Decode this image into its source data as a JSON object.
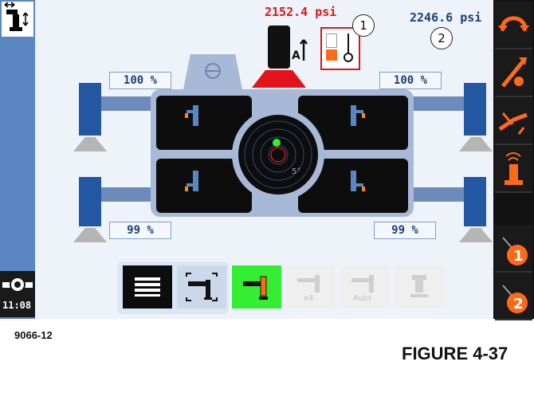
{
  "pressures": {
    "left": "2152.4 psi",
    "right": "2246.6 psi"
  },
  "callouts": {
    "one": "1",
    "two": "2"
  },
  "outriggers": {
    "front_left": "100 %",
    "front_right": "100 %",
    "rear_left": "99 %",
    "rear_right": "99 %"
  },
  "level": {
    "angle": "5°"
  },
  "clock": "11:08",
  "toolbar": {
    "x4_label": "x4",
    "auto_label": "Auto"
  },
  "figure": {
    "code": "9066-12",
    "title": "FIGURE 4-37"
  },
  "colors": {
    "panel_bg": "#eef3fa",
    "accent_blue": "#5a86c2",
    "pressure_red": "#e3121b",
    "active_green": "#33ee33",
    "orange": "#ff6a1a"
  },
  "right_buttons": [
    "swing-icon",
    "telescope-icon",
    "boom-lift-icon",
    "horn-icon",
    "warning-1-icon",
    "warning-2-icon"
  ]
}
